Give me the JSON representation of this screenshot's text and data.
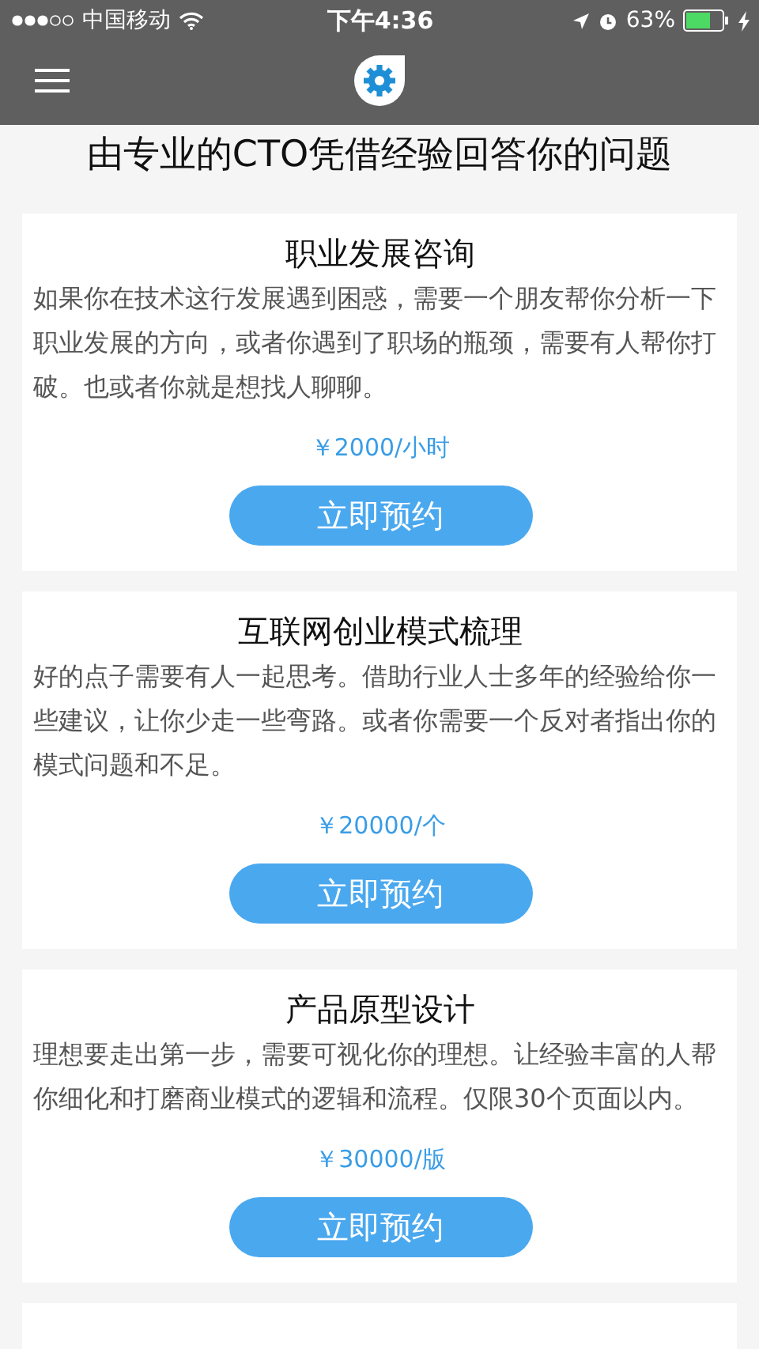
{
  "status_bar": {
    "carrier": "中国移动",
    "time": "下午4:36",
    "battery": "63%"
  },
  "headline": "由专业的CTO凭借经验回答你的问题",
  "services": [
    {
      "title": "职业发展咨询",
      "description": "如果你在技术这行发展遇到困惑，需要一个朋友帮你分析一下职业发展的方向，或者你遇到了职场的瓶颈，需要有人帮你打破。也或者你就是想找人聊聊。",
      "price": "￥2000/小时",
      "button": "立即预约"
    },
    {
      "title": "互联网创业模式梳理",
      "description": "好的点子需要有人一起思考。借助行业人士多年的经验给你一些建议，让你少走一些弯路。或者你需要一个反对者指出你的模式问题和不足。",
      "price": "￥20000/个",
      "button": "立即预约"
    },
    {
      "title": "产品原型设计",
      "description": "理想要走出第一步，需要可视化你的理想。让经验丰富的人帮你细化和打磨商业模式的逻辑和流程。仅限30个页面以内。",
      "price": "￥30000/版",
      "button": "立即预约"
    }
  ]
}
